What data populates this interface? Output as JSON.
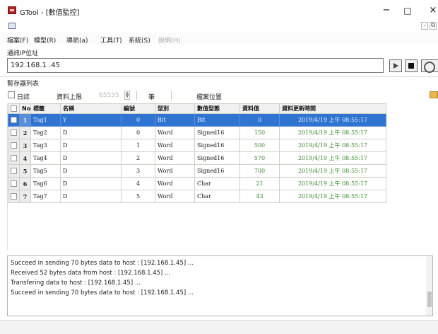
{
  "window": {
    "title": "GTool - [數值監控]",
    "minimize": "−",
    "maximize": "□",
    "close": "×"
  },
  "mdi": {
    "minimize": "-",
    "restore": "⧉"
  },
  "menu": [
    {
      "label": "檔案(F)"
    },
    {
      "label": "模型(R)"
    },
    {
      "label": "導航(a)"
    },
    {
      "label": "工具(T)"
    },
    {
      "label": "系統(S)"
    },
    {
      "label": "說明(H)",
      "disabled": true
    }
  ],
  "connection": {
    "label": "通訊IP位址",
    "ip_value": "192.168.1 .45"
  },
  "registers": {
    "label": "暫存器列表",
    "log_label": "日誌",
    "upper_limit_label": "資料上限",
    "upper_limit_value": "65535",
    "unit_label": "筆",
    "file_location_label": "檔案位置"
  },
  "table": {
    "columns": [
      "",
      "No",
      "標籤",
      "名稱",
      "編號",
      "型別",
      "數值型態",
      "資料值",
      "資料更新時間"
    ],
    "rows": [
      {
        "no": "1",
        "tag": "Tag1",
        "name": "Y",
        "id": "0",
        "type": "Bit",
        "value_type": "Bit",
        "value": "0",
        "updated": "2019/4/19 上午 08:55:17"
      },
      {
        "no": "2",
        "tag": "Tag2",
        "name": "D",
        "id": "0",
        "type": "Word",
        "value_type": "Signed16",
        "value": "150",
        "updated": "2019/4/19 上午 08:55:17"
      },
      {
        "no": "3",
        "tag": "Tag3",
        "name": "D",
        "id": "1",
        "type": "Word",
        "value_type": "Signed16",
        "value": "500",
        "updated": "2019/4/19 上午 08:55:17"
      },
      {
        "no": "4",
        "tag": "Tag4",
        "name": "D",
        "id": "2",
        "type": "Word",
        "value_type": "Signed16",
        "value": "570",
        "updated": "2019/4/19 上午 08:55:17"
      },
      {
        "no": "5",
        "tag": "Tag5",
        "name": "D",
        "id": "3",
        "type": "Word",
        "value_type": "Signed16",
        "value": "700",
        "updated": "2019/4/19 上午 08:55:17"
      },
      {
        "no": "6",
        "tag": "Tag6",
        "name": "D",
        "id": "4",
        "type": "Word",
        "value_type": "Char",
        "value": "21",
        "updated": "2019/4/19 上午 08:55:17"
      },
      {
        "no": "7",
        "tag": "Tag7",
        "name": "D",
        "id": "5",
        "type": "Word",
        "value_type": "Char",
        "value": "43",
        "updated": "2019/4/19 上午 08:55:17"
      }
    ]
  },
  "log": [
    "Succeed in sending 70 bytes data to host : [192.168.1.45] ...",
    "Received 52 bytes data from host : [192.168.1.45] ...",
    "Transfering data to host : [192.168.1.45] ...",
    "Succeed in sending 70 bytes data to host : [192.168.1.45] ..."
  ],
  "colors": {
    "selected_row": "#2f74d0",
    "value_text": "#3b8a2e",
    "app_icon": "#b22222"
  }
}
